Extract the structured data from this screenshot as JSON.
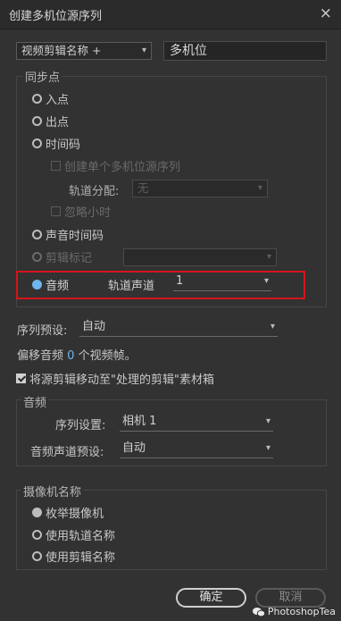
{
  "window": {
    "title": "创建多机位源序列",
    "close_glyph": "×"
  },
  "name_row": {
    "dropdown_value": "视频剪辑名称 +",
    "name_input": "多机位"
  },
  "sync_point": {
    "title": "同步点",
    "in_point": "入点",
    "out_point": "出点",
    "timecode": "时间码",
    "create_single": "创建单个多机位源序列",
    "track_assign_label": "轨道分配:",
    "track_assign_value": "无",
    "ignore_hours": "忽略小时",
    "sound_timecode": "声音时间码",
    "clip_marker": "剪辑标记",
    "audio": "音频",
    "track_channel_label": "轨道声道",
    "track_channel_value": "1"
  },
  "sequence_preset": {
    "label": "序列预设:",
    "value": "自动"
  },
  "offset_audio": {
    "prefix": "偏移音频",
    "value": "0",
    "suffix": "个视频帧。"
  },
  "move_clips": {
    "label": "将源剪辑移动至\"处理的剪辑\"素材箱"
  },
  "audio_group": {
    "title": "音频",
    "sequence_settings_label": "序列设置:",
    "sequence_settings_value": "相机 1",
    "channel_preset_label": "音频声道预设:",
    "channel_preset_value": "自动"
  },
  "camera_names": {
    "title": "摄像机名称",
    "enumerate": "枚举摄像机",
    "use_track_names": "使用轨道名称",
    "use_clip_names": "使用剪辑名称"
  },
  "buttons": {
    "ok": "确定",
    "cancel": "取消"
  },
  "watermark": "PhotoshopTea",
  "icons": {
    "chevron": "▾"
  }
}
